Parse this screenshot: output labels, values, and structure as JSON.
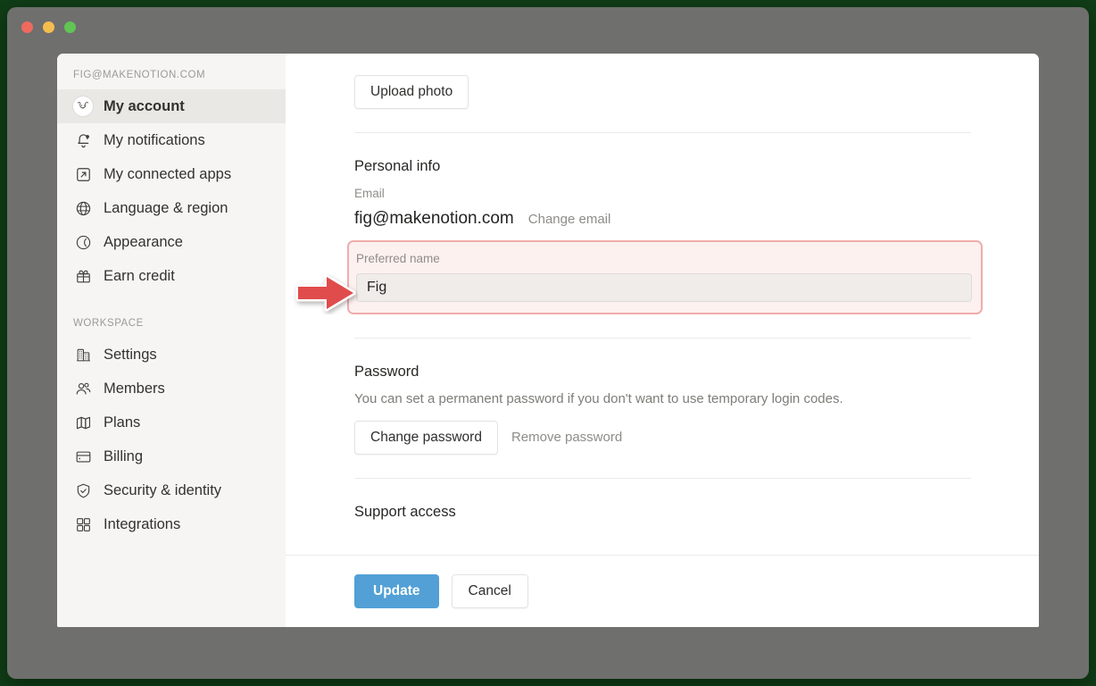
{
  "window": {
    "traffic_lights": [
      {
        "name": "close",
        "color": "#ee6a5f"
      },
      {
        "name": "minimize",
        "color": "#f5bd4f"
      },
      {
        "name": "zoom",
        "color": "#61c454"
      }
    ]
  },
  "sidebar": {
    "account_label": "FIG@MAKENOTION.COM",
    "account_items": [
      {
        "label": "My account",
        "icon": "avatar-icon",
        "active": true
      },
      {
        "label": "My notifications",
        "icon": "bell-icon",
        "active": false
      },
      {
        "label": "My connected apps",
        "icon": "external-link-icon",
        "active": false
      },
      {
        "label": "Language & region",
        "icon": "globe-icon",
        "active": false
      },
      {
        "label": "Appearance",
        "icon": "moon-icon",
        "active": false
      },
      {
        "label": "Earn credit",
        "icon": "gift-icon",
        "active": false
      }
    ],
    "workspace_label": "WORKSPACE",
    "workspace_items": [
      {
        "label": "Settings",
        "icon": "building-icon"
      },
      {
        "label": "Members",
        "icon": "people-icon"
      },
      {
        "label": "Plans",
        "icon": "map-icon"
      },
      {
        "label": "Billing",
        "icon": "credit-card-icon"
      },
      {
        "label": "Security & identity",
        "icon": "shield-check-icon"
      },
      {
        "label": "Integrations",
        "icon": "grid-icon"
      }
    ]
  },
  "main": {
    "upload_photo_label": "Upload photo",
    "personal_info": {
      "title": "Personal info",
      "email_label": "Email",
      "email_value": "fig@makenotion.com",
      "change_email_label": "Change email",
      "preferred_name_label": "Preferred name",
      "preferred_name_value": "Fig",
      "preferred_name_placeholder": "Preferred name"
    },
    "password": {
      "title": "Password",
      "description": "You can set a permanent password if you don't want to use temporary login codes.",
      "change_password_label": "Change password",
      "remove_password_label": "Remove password"
    },
    "support_access": {
      "title": "Support access"
    }
  },
  "footer": {
    "update_label": "Update",
    "cancel_label": "Cancel"
  },
  "annotation": {
    "type": "arrow",
    "direction": "right",
    "color": "#e04c4c",
    "outline_color": "#ffffff",
    "points_at": "preferred-name-field"
  },
  "colors": {
    "accent_blue": "#52a0d6",
    "highlight_border": "#efadac",
    "highlight_fill": "#fdf1f0",
    "sidebar_bg": "#f6f5f3",
    "sidebar_active_bg": "#e9e8e5",
    "window_chrome": "#6f6f6d"
  }
}
